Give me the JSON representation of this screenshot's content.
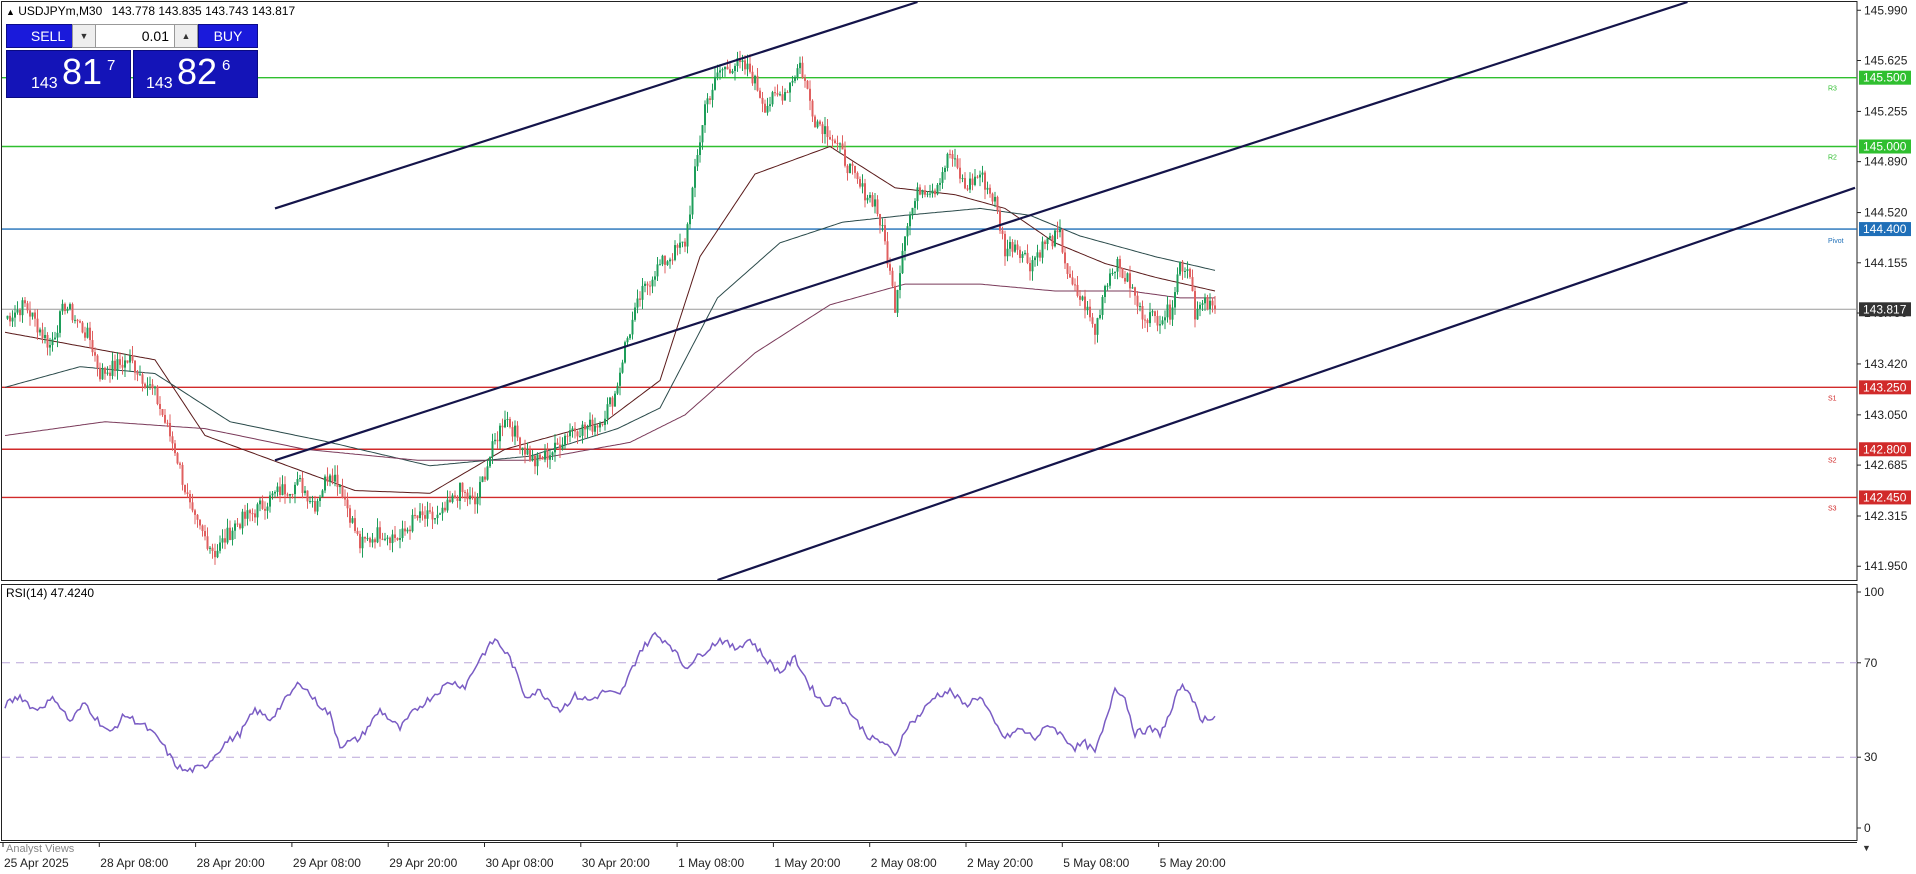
{
  "chart_header": {
    "symbol": "USDJPYm,M30",
    "ohlc": "143.778 143.835 143.743 143.817"
  },
  "trade_panel": {
    "sell_label": "SELL",
    "buy_label": "BUY",
    "lot": "0.01",
    "sell_price": {
      "big": "143",
      "main": "81",
      "sup": "7"
    },
    "buy_price": {
      "big": "143",
      "main": "82",
      "sup": "6"
    }
  },
  "indicator": {
    "label": "RSI(14) 47.4240"
  },
  "footer_tab": "Analyst Views",
  "colors": {
    "bull": "#1e9e5a",
    "bear": "#e06060",
    "resistance": "#2fbf2f",
    "support": "#d12a2a",
    "pivot": "#1f6fb8",
    "channel": "#14144a",
    "rsi": "#7a5cc4"
  },
  "chart_data": [
    {
      "type": "candlestick",
      "title": "USDJPYm,M30",
      "ylim": [
        141.85,
        146.05
      ],
      "y_ticks": [
        "145.990",
        "145.625",
        "145.255",
        "144.890",
        "144.520",
        "144.155",
        "143.790",
        "143.420",
        "143.050",
        "142.685",
        "142.315",
        "141.950"
      ],
      "x_ticks": [
        "25 Apr 2025",
        "28 Apr 08:00",
        "28 Apr 20:00",
        "29 Apr 08:00",
        "29 Apr 20:00",
        "30 Apr 08:00",
        "30 Apr 20:00",
        "1 May 08:00",
        "1 May 20:00",
        "2 May 08:00",
        "2 May 20:00",
        "5 May 08:00",
        "5 May 20:00"
      ],
      "current_price": {
        "value": 143.817,
        "label": "143.817"
      },
      "levels": [
        {
          "name": "R3",
          "value": 145.5,
          "label": "145.500",
          "kind": "resistance"
        },
        {
          "name": "R2",
          "value": 145.0,
          "label": "145.000",
          "kind": "resistance"
        },
        {
          "name": "Pivot",
          "value": 144.4,
          "label": "144.400",
          "kind": "pivot"
        },
        {
          "name": "S1",
          "value": 143.25,
          "label": "143.250",
          "kind": "support"
        },
        {
          "name": "S2",
          "value": 142.8,
          "label": "142.800",
          "kind": "support"
        },
        {
          "name": "S3",
          "value": 142.45,
          "label": "142.450",
          "kind": "support"
        }
      ],
      "close_path": [
        [
          0,
          143.75
        ],
        [
          8,
          143.85
        ],
        [
          18,
          143.55
        ],
        [
          24,
          143.85
        ],
        [
          34,
          143.6
        ],
        [
          38,
          143.35
        ],
        [
          50,
          143.45
        ],
        [
          60,
          143.2
        ],
        [
          68,
          142.8
        ],
        [
          75,
          142.3
        ],
        [
          84,
          142.05
        ],
        [
          92,
          142.25
        ],
        [
          100,
          142.35
        ],
        [
          110,
          142.5
        ],
        [
          118,
          142.55
        ],
        [
          124,
          142.4
        ],
        [
          130,
          142.65
        ],
        [
          134,
          142.55
        ],
        [
          142,
          142.1
        ],
        [
          150,
          142.2
        ],
        [
          158,
          142.15
        ],
        [
          164,
          142.3
        ],
        [
          174,
          142.3
        ],
        [
          182,
          142.5
        ],
        [
          188,
          142.4
        ],
        [
          194,
          142.75
        ],
        [
          200,
          143.05
        ],
        [
          206,
          142.85
        ],
        [
          212,
          142.7
        ],
        [
          220,
          142.8
        ],
        [
          226,
          142.95
        ],
        [
          232,
          142.95
        ],
        [
          238,
          143.0
        ],
        [
          244,
          143.2
        ],
        [
          248,
          143.55
        ],
        [
          254,
          143.9
        ],
        [
          260,
          144.1
        ],
        [
          266,
          144.2
        ],
        [
          272,
          144.3
        ],
        [
          280,
          145.3
        ],
        [
          286,
          145.55
        ],
        [
          292,
          145.6
        ],
        [
          298,
          145.55
        ],
        [
          304,
          145.3
        ],
        [
          312,
          145.4
        ],
        [
          318,
          145.6
        ],
        [
          324,
          145.2
        ],
        [
          330,
          145.1
        ],
        [
          336,
          144.9
        ],
        [
          342,
          144.7
        ],
        [
          348,
          144.6
        ],
        [
          352,
          144.3
        ],
        [
          356,
          143.85
        ],
        [
          360,
          144.4
        ],
        [
          366,
          144.7
        ],
        [
          372,
          144.7
        ],
        [
          378,
          144.95
        ],
        [
          384,
          144.7
        ],
        [
          390,
          144.8
        ],
        [
          396,
          144.6
        ],
        [
          400,
          144.25
        ],
        [
          404,
          144.3
        ],
        [
          410,
          144.15
        ],
        [
          416,
          144.3
        ],
        [
          422,
          144.35
        ],
        [
          426,
          144.0
        ],
        [
          432,
          143.85
        ],
        [
          436,
          143.65
        ],
        [
          440,
          144.0
        ],
        [
          444,
          144.15
        ],
        [
          450,
          144.0
        ],
        [
          454,
          143.8
        ],
        [
          460,
          143.75
        ],
        [
          466,
          143.8
        ],
        [
          470,
          144.15
        ],
        [
          474,
          144.1
        ],
        [
          476,
          143.8
        ],
        [
          480,
          143.85
        ],
        [
          484,
          143.817
        ]
      ],
      "moving_averages": [
        {
          "color": "#5a1a1a",
          "path": [
            [
              0,
              143.65
            ],
            [
              30,
              143.55
            ],
            [
              60,
              143.45
            ],
            [
              80,
              142.9
            ],
            [
              110,
              142.7
            ],
            [
              140,
              142.5
            ],
            [
              170,
              142.48
            ],
            [
              200,
              142.8
            ],
            [
              240,
              143.0
            ],
            [
              262,
              143.3
            ],
            [
              278,
              144.2
            ],
            [
              300,
              144.8
            ],
            [
              330,
              145.0
            ],
            [
              356,
              144.7
            ],
            [
              380,
              144.65
            ],
            [
              400,
              144.55
            ],
            [
              420,
              144.3
            ],
            [
              440,
              144.15
            ],
            [
              460,
              144.05
            ],
            [
              484,
              143.95
            ]
          ]
        },
        {
          "color": "#2a4a4a",
          "path": [
            [
              0,
              143.25
            ],
            [
              30,
              143.4
            ],
            [
              60,
              143.35
            ],
            [
              90,
              143.0
            ],
            [
              130,
              142.85
            ],
            [
              170,
              142.68
            ],
            [
              210,
              142.75
            ],
            [
              245,
              142.95
            ],
            [
              262,
              143.1
            ],
            [
              285,
              143.9
            ],
            [
              310,
              144.3
            ],
            [
              335,
              144.45
            ],
            [
              360,
              144.5
            ],
            [
              390,
              144.55
            ],
            [
              410,
              144.5
            ],
            [
              430,
              144.35
            ],
            [
              460,
              144.2
            ],
            [
              484,
              144.1
            ]
          ]
        },
        {
          "color": "#7a3a5a",
          "path": [
            [
              0,
              142.9
            ],
            [
              40,
              143.0
            ],
            [
              80,
              142.95
            ],
            [
              120,
              142.8
            ],
            [
              165,
              142.72
            ],
            [
              210,
              142.72
            ],
            [
              250,
              142.85
            ],
            [
              272,
              143.05
            ],
            [
              300,
              143.5
            ],
            [
              330,
              143.85
            ],
            [
              360,
              144.0
            ],
            [
              390,
              144.0
            ],
            [
              420,
              143.95
            ],
            [
              450,
              143.95
            ],
            [
              470,
              143.9
            ],
            [
              484,
              143.9
            ]
          ]
        }
      ],
      "channel_lines": [
        {
          "from": [
            108,
            144.55
          ],
          "to": [
            365,
            146.05
          ]
        },
        {
          "from": [
            108,
            142.72
          ],
          "to": [
            673,
            146.05
          ]
        },
        {
          "from": [
            285,
            141.85
          ],
          "to": [
            740,
            144.7
          ]
        }
      ]
    },
    {
      "type": "line",
      "title": "RSI(14) 47.4240",
      "ylim": [
        0,
        100
      ],
      "y_ticks": [
        "100",
        "70",
        "30",
        "0"
      ],
      "levels": [
        70,
        30
      ],
      "series": [
        {
          "values": [
            [
              0,
              52
            ],
            [
              6,
              56
            ],
            [
              12,
              50
            ],
            [
              20,
              55
            ],
            [
              26,
              45
            ],
            [
              32,
              53
            ],
            [
              36,
              47
            ],
            [
              42,
              40
            ],
            [
              48,
              48
            ],
            [
              56,
              43
            ],
            [
              62,
              37
            ],
            [
              68,
              27
            ],
            [
              72,
              24
            ],
            [
              80,
              26
            ],
            [
              88,
              36
            ],
            [
              94,
              40
            ],
            [
              100,
              50
            ],
            [
              106,
              46
            ],
            [
              112,
              54
            ],
            [
              118,
              62
            ],
            [
              124,
              54
            ],
            [
              130,
              48
            ],
            [
              134,
              35
            ],
            [
              142,
              38
            ],
            [
              150,
              50
            ],
            [
              158,
              42
            ],
            [
              164,
              50
            ],
            [
              170,
              55
            ],
            [
              178,
              62
            ],
            [
              184,
              60
            ],
            [
              190,
              72
            ],
            [
              196,
              80
            ],
            [
              202,
              72
            ],
            [
              208,
              56
            ],
            [
              214,
              58
            ],
            [
              222,
              50
            ],
            [
              228,
              56
            ],
            [
              234,
              54
            ],
            [
              240,
              58
            ],
            [
              246,
              56
            ],
            [
              254,
              75
            ],
            [
              260,
              82
            ],
            [
              266,
              78
            ],
            [
              272,
              68
            ],
            [
              280,
              75
            ],
            [
              286,
              80
            ],
            [
              292,
              76
            ],
            [
              298,
              80
            ],
            [
              304,
              72
            ],
            [
              310,
              66
            ],
            [
              316,
              72
            ],
            [
              322,
              60
            ],
            [
              328,
              52
            ],
            [
              334,
              56
            ],
            [
              340,
              46
            ],
            [
              346,
              38
            ],
            [
              352,
              36
            ],
            [
              356,
              30
            ],
            [
              360,
              42
            ],
            [
              366,
              48
            ],
            [
              372,
              56
            ],
            [
              378,
              58
            ],
            [
              384,
              52
            ],
            [
              390,
              56
            ],
            [
              396,
              44
            ],
            [
              400,
              38
            ],
            [
              406,
              42
            ],
            [
              412,
              38
            ],
            [
              418,
              44
            ],
            [
              424,
              38
            ],
            [
              428,
              34
            ],
            [
              432,
              36
            ],
            [
              436,
              32
            ],
            [
              440,
              44
            ],
            [
              444,
              60
            ],
            [
              448,
              55
            ],
            [
              452,
              40
            ],
            [
              458,
              42
            ],
            [
              462,
              40
            ],
            [
              466,
              48
            ],
            [
              470,
              60
            ],
            [
              474,
              58
            ],
            [
              478,
              46
            ],
            [
              484,
              47.4
            ]
          ]
        }
      ]
    }
  ]
}
